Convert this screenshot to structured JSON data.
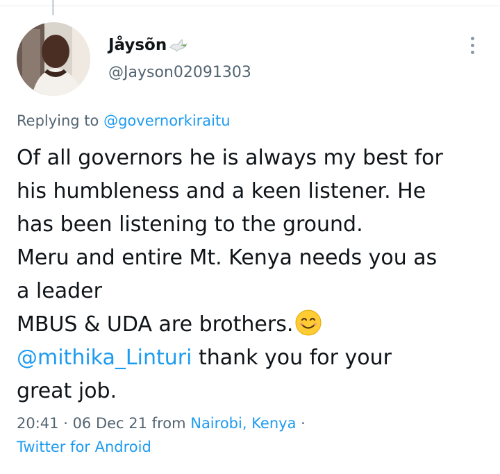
{
  "tweet": {
    "author": {
      "display_name": "Jåysõn",
      "badge_icon": "dove-icon",
      "handle": "@Jayson02091303"
    },
    "replying": {
      "prefix": "Replying to",
      "mention": "@governorkiraitu"
    },
    "body": {
      "line1": "Of all governors he is always my best for",
      "line2": "his humbleness and a keen listener. He",
      "line3": "has been listening to the ground.",
      "line4": "Meru and entire Mt. Kenya needs you as",
      "line5": "a leader",
      "line6": "MBUS & UDA are brothers.",
      "line6_emoji": "smiling-face-icon",
      "mention": "@mithika_Linturi",
      "line7_rest": " thank you for your",
      "line8": "great job."
    },
    "meta": {
      "time": "20:41",
      "sep1": " · ",
      "date": "06 Dec 21",
      "from_word": " from ",
      "location": "Nairobi, Kenya",
      "sep2": " ·",
      "source": "Twitter for Android"
    }
  },
  "colors": {
    "link": "#1d9bf0",
    "secondary_text": "#536471",
    "primary_text": "#0f1419"
  }
}
